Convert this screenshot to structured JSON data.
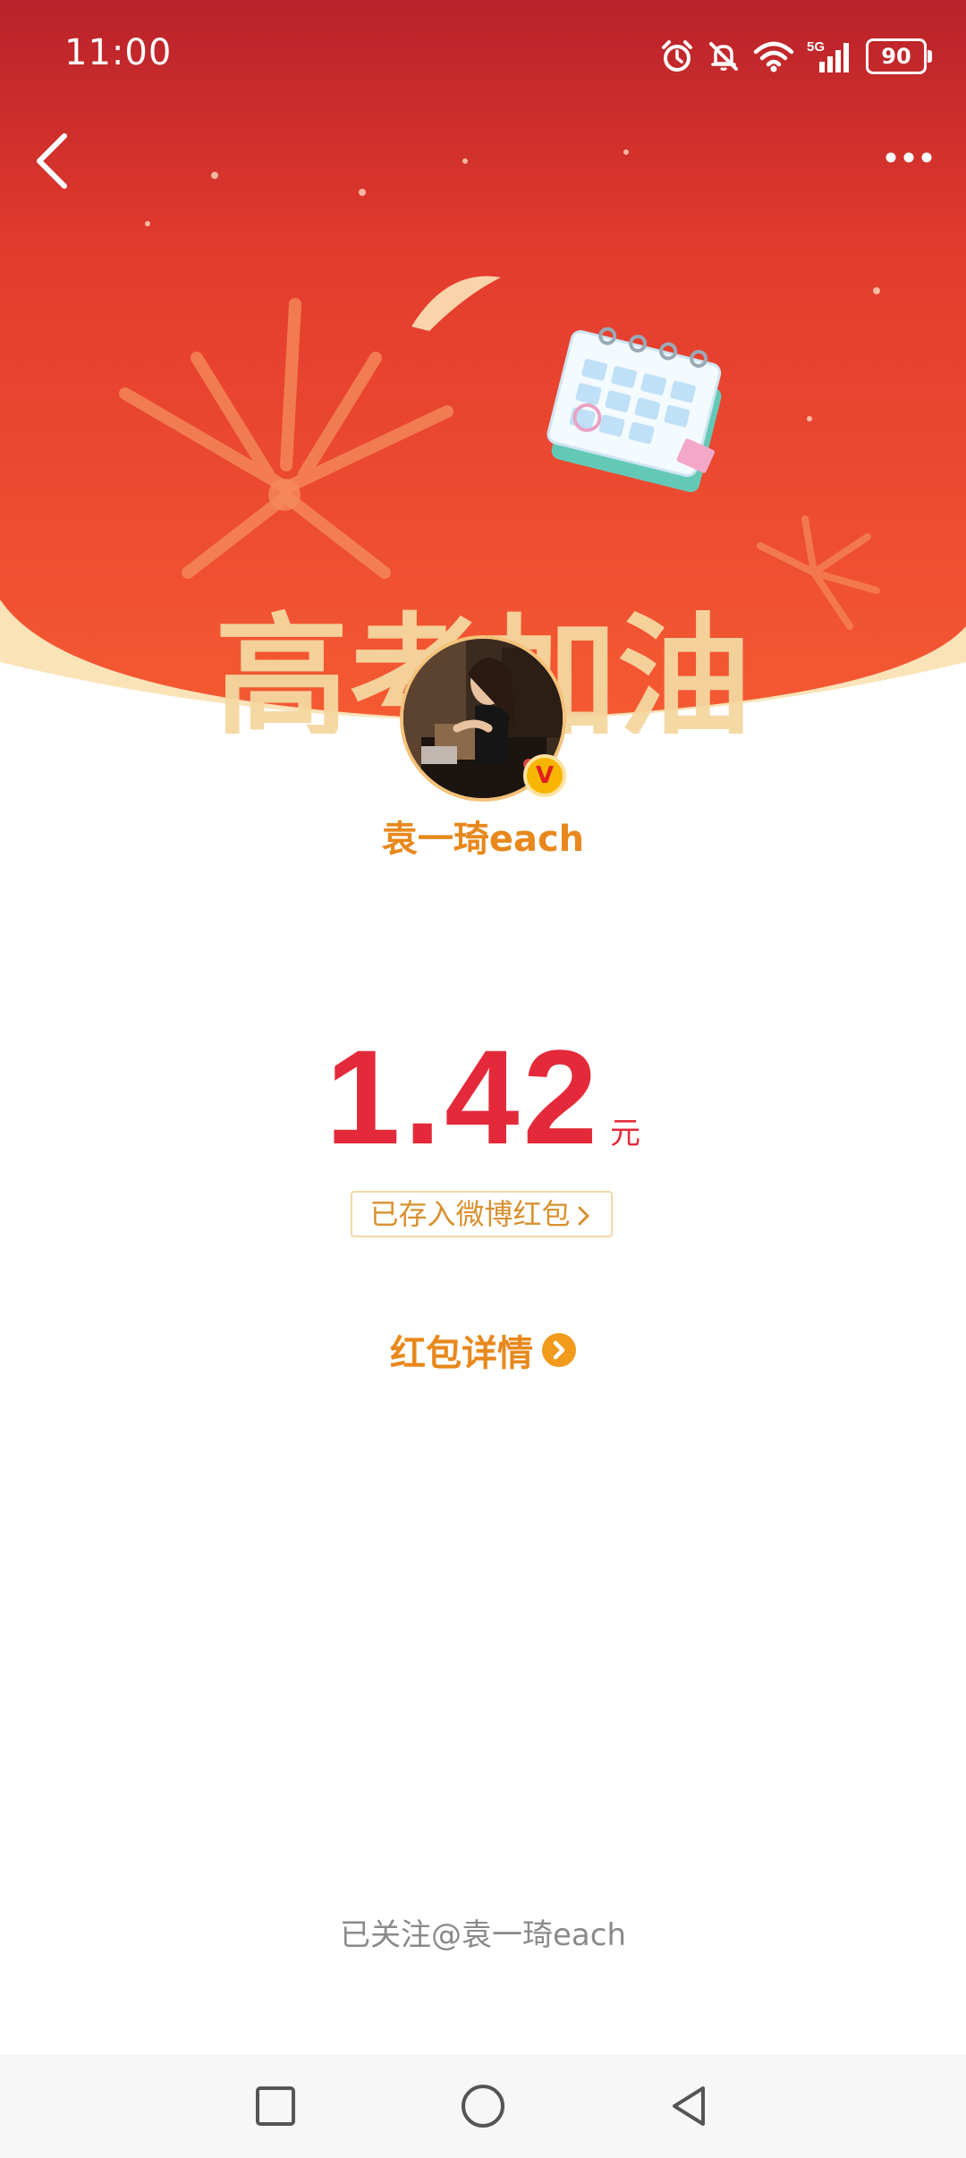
{
  "status_bar": {
    "time": "11:00",
    "network": "5G",
    "battery": "90",
    "icons": [
      "alarm-icon",
      "mute-icon",
      "wifi-icon",
      "signal-icon",
      "battery-icon"
    ]
  },
  "header": {
    "back_icon": "chevron-left-icon",
    "more_icon": "more-dots-icon",
    "banner_slogan": "高考加油",
    "colors": {
      "banner_top": "#c8262b",
      "banner_bottom": "#f25a32",
      "arc": "#fbe3b8"
    }
  },
  "sender": {
    "name": "袁一琦each",
    "verified_badge": "V"
  },
  "red_packet": {
    "amount": "1.42",
    "unit": "元",
    "saved_label": "已存入微博红包",
    "details_label": "红包详情"
  },
  "footer": {
    "followed_text": "已关注@袁一琦each"
  },
  "nav_bar": {
    "buttons": [
      "recents-square-icon",
      "home-circle-icon",
      "back-triangle-icon"
    ]
  },
  "colors": {
    "accent_orange": "#e8881c",
    "amount_red": "#e42a3a"
  }
}
